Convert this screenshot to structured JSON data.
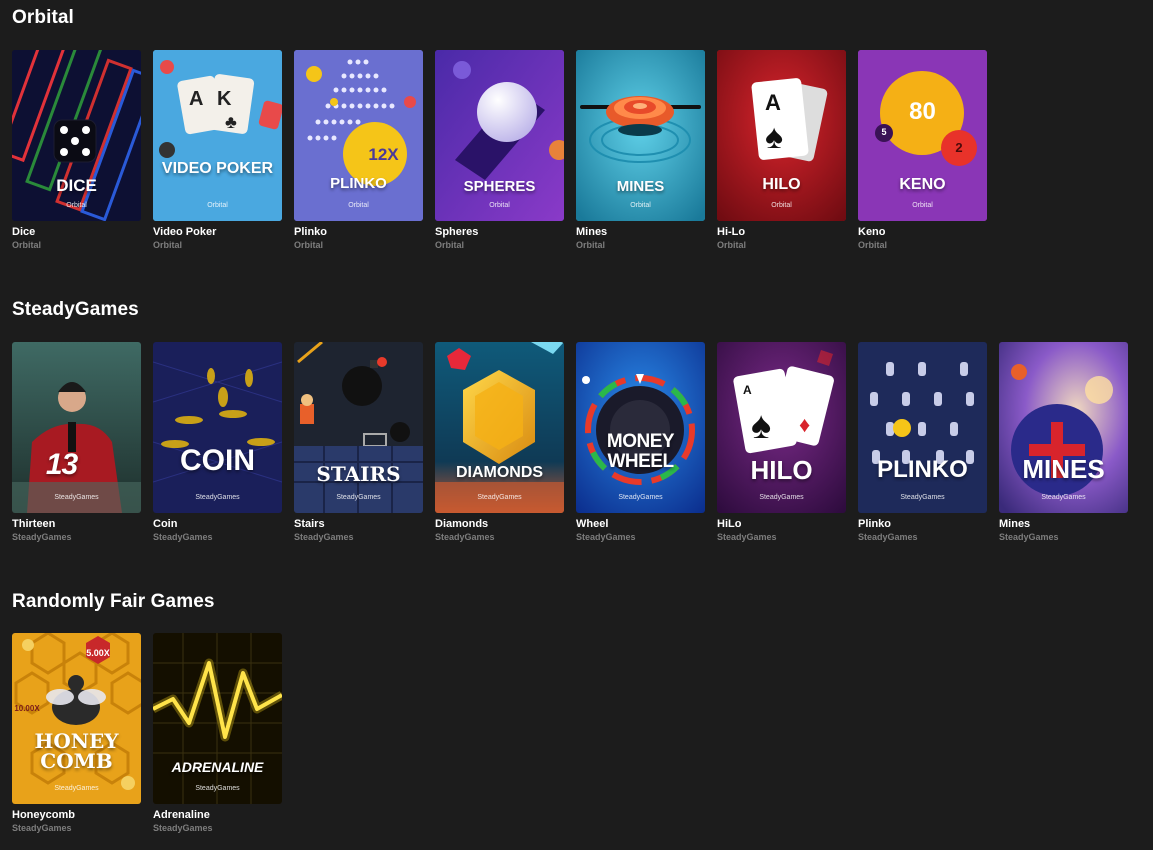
{
  "sections": [
    {
      "title": "Orbital",
      "games": [
        {
          "name": "Dice",
          "provider": "Orbital",
          "art": "DICE",
          "color": "#0d1033"
        },
        {
          "name": "Video Poker",
          "provider": "Orbital",
          "art": "VIDEO POKER",
          "color": "#4aa8e0"
        },
        {
          "name": "Plinko",
          "provider": "Orbital",
          "art": "PLINKO",
          "color": "#6a6fd0",
          "multiplier": "12X"
        },
        {
          "name": "Spheres",
          "provider": "Orbital",
          "art": "SPHERES",
          "color": "#5a2fb8"
        },
        {
          "name": "Mines",
          "provider": "Orbital",
          "art": "MINES",
          "color": "#2aa3c4"
        },
        {
          "name": "Hi-Lo",
          "provider": "Orbital",
          "art": "HILO",
          "color": "#b5131c"
        },
        {
          "name": "Keno",
          "provider": "Orbital",
          "art": "KENO",
          "color": "#8a36b6",
          "ball_big": "80",
          "ball_small": "2",
          "ball_tiny": "5"
        }
      ]
    },
    {
      "title": "SteadyGames",
      "games": [
        {
          "name": "Thirteen",
          "provider": "SteadyGames",
          "art": "13",
          "color": "#2f4a45"
        },
        {
          "name": "Coin",
          "provider": "SteadyGames",
          "art": "COIN",
          "color": "#1a1f5a"
        },
        {
          "name": "Stairs",
          "provider": "SteadyGames",
          "art": "STAIRS",
          "color": "#1e2430"
        },
        {
          "name": "Diamonds",
          "provider": "SteadyGames",
          "art": "DIAMONDS",
          "color": "#0f4a6a"
        },
        {
          "name": "Wheel",
          "provider": "SteadyGames",
          "art": "MONEY WHEEL",
          "color": "#1656c8"
        },
        {
          "name": "HiLo",
          "provider": "SteadyGames",
          "art": "HILO",
          "color": "#5a1a66"
        },
        {
          "name": "Plinko",
          "provider": "SteadyGames",
          "art": "PLINKO",
          "color": "#1e2a5a"
        },
        {
          "name": "Mines",
          "provider": "SteadyGames",
          "art": "MINES",
          "color": "#5a3aa6"
        }
      ]
    },
    {
      "title": "Randomly Fair Games",
      "games": [
        {
          "name": "Honeycomb",
          "provider": "SteadyGames",
          "art": "HONEY COMB",
          "color": "#e8a21a",
          "mult_a": "5.00X",
          "mult_b": "10.00X"
        },
        {
          "name": "Adrenaline",
          "provider": "SteadyGames",
          "art": "ADRENALINE",
          "color": "#1a1400"
        }
      ]
    }
  ]
}
